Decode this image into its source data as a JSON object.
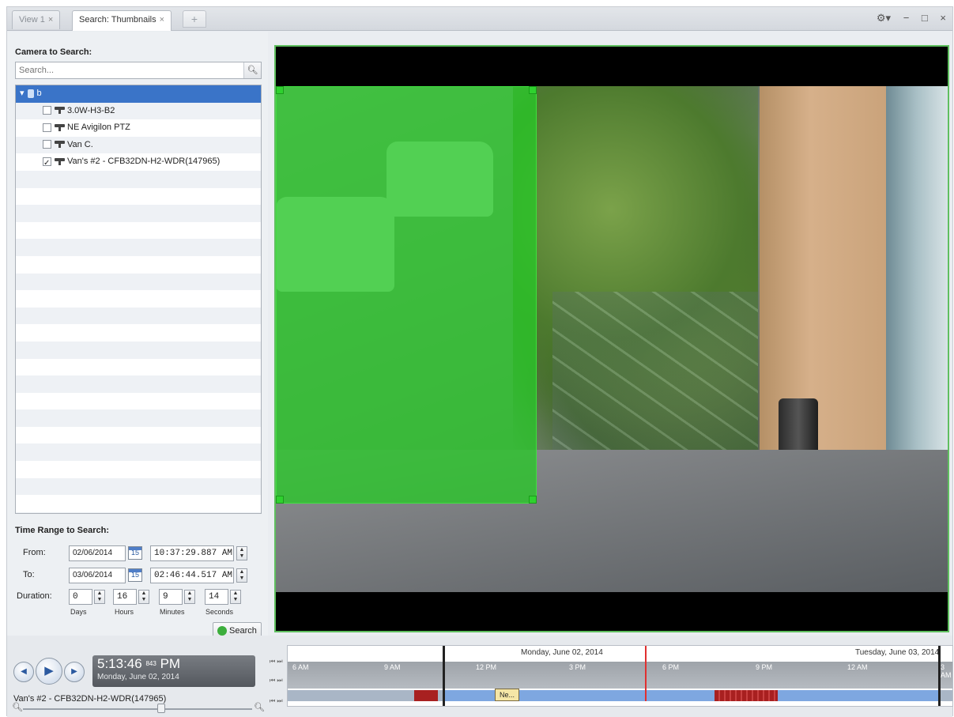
{
  "tabs": [
    {
      "label": "View 1",
      "active": false
    },
    {
      "label": "Search: Thumbnails",
      "active": true
    }
  ],
  "tab_add_label": "+",
  "window_controls": {
    "settings": "⚙▾",
    "minimize": "−",
    "maximize": "□",
    "close": "×"
  },
  "camera_section": {
    "title": "Camera to Search:",
    "search_placeholder": "Search...",
    "tree": {
      "root": "b",
      "cameras": [
        {
          "label": "3.0W-H3-B2",
          "checked": false
        },
        {
          "label": "NE Avigilon PTZ",
          "checked": false
        },
        {
          "label": "Van C.",
          "checked": false
        },
        {
          "label": "Van's #2 - CFB32DN-H2-WDR(147965)",
          "checked": true
        }
      ]
    }
  },
  "time_range": {
    "title": "Time Range to Search:",
    "from_label": "From:",
    "to_label": "To:",
    "duration_label": "Duration:",
    "from_date": "02/06/2014",
    "from_time": "10:37:29.887 AM",
    "to_date": "03/06/2014",
    "to_time": "02:46:44.517 AM",
    "calendar_day": "15",
    "duration": {
      "days": "0",
      "hours": "16",
      "minutes": "9",
      "seconds": "14"
    },
    "duration_units": {
      "days": "Days",
      "hours": "Hours",
      "minutes": "Minutes",
      "seconds": "Seconds"
    },
    "search_button": "Search"
  },
  "playback": {
    "time": "5:13:46",
    "ms": "843",
    "ampm": "PM",
    "date": "Monday, June 02, 2014",
    "camera_name": "Van's #2 - CFB32DN-H2-WDR(147965)"
  },
  "timeline": {
    "day1_label": "Monday, June 02, 2014",
    "day2_label": "Tuesday, June 03, 2014",
    "ticks": [
      "6 AM",
      "9 AM",
      "12 PM",
      "3 PM",
      "6 PM",
      "9 PM",
      "12 AM",
      "3 AM"
    ],
    "bookmark_label": "Ne..."
  },
  "colors": {
    "selection_green": "#28c828",
    "accent_blue": "#3a74c8",
    "recording_blue": "#7ea7e0",
    "motion_red": "#a82020",
    "cursor_red": "#e03030"
  }
}
